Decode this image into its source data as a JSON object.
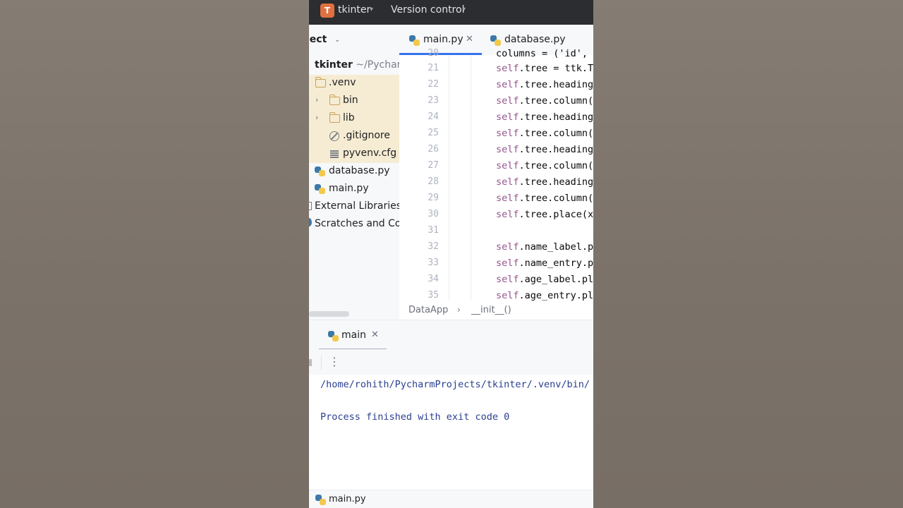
{
  "titlebar": {
    "project_badge": "T",
    "project_name": "tkinter",
    "version_control": "Version control"
  },
  "project_panel": {
    "title": "ject",
    "root": {
      "name": "tkinter",
      "path": "~/Pycharm"
    },
    "items": [
      {
        "label": ".venv",
        "icon": "folder-icon"
      },
      {
        "label": "bin",
        "icon": "folder-icon"
      },
      {
        "label": "lib",
        "icon": "folder-icon"
      },
      {
        "label": ".gitignore",
        "icon": "ignore-file-icon"
      },
      {
        "label": "pyvenv.cfg",
        "icon": "text-file-icon"
      },
      {
        "label": "database.py",
        "icon": "python-icon"
      },
      {
        "label": "main.py",
        "icon": "python-icon"
      },
      {
        "label": "External Libraries",
        "icon": "library-icon"
      },
      {
        "label": "Scratches and Con",
        "icon": "scratches-icon"
      }
    ]
  },
  "editor": {
    "tabs": [
      {
        "label": "main.py",
        "active": true
      },
      {
        "label": "database.py",
        "active": false
      }
    ],
    "partial_line": "columns = ('id',",
    "lines": [
      {
        "num": "21",
        "self": "self",
        "rest": ".tree = ttk.T"
      },
      {
        "num": "22",
        "self": "self",
        "rest": ".tree.heading"
      },
      {
        "num": "23",
        "self": "self",
        "rest": ".tree.column("
      },
      {
        "num": "24",
        "self": "self",
        "rest": ".tree.heading"
      },
      {
        "num": "25",
        "self": "self",
        "rest": ".tree.column("
      },
      {
        "num": "26",
        "self": "self",
        "rest": ".tree.heading"
      },
      {
        "num": "27",
        "self": "self",
        "rest": ".tree.column("
      },
      {
        "num": "28",
        "self": "self",
        "rest": ".tree.heading"
      },
      {
        "num": "29",
        "self": "self",
        "rest": ".tree.column("
      },
      {
        "num": "30",
        "self": "self",
        "rest": ".tree.place(x"
      },
      {
        "num": "31",
        "self": "",
        "rest": ""
      },
      {
        "num": "32",
        "self": "self",
        "rest": ".name_label.p"
      },
      {
        "num": "33",
        "self": "self",
        "rest": ".name_entry.p"
      },
      {
        "num": "34",
        "self": "self",
        "rest": ".age_label.pl"
      },
      {
        "num": "35",
        "self": "self",
        "rest": ".age_entry.pl"
      }
    ],
    "breadcrumb": {
      "class": "DataApp",
      "method": "__init__()"
    }
  },
  "run_panel": {
    "tab_label": "main",
    "console_lines": [
      "/home/rohith/PycharmProjects/tkinter/.venv/bin/",
      "",
      "Process finished with exit code 0"
    ]
  },
  "status_bar": {
    "file": "main.py"
  },
  "colors": {
    "accent": "#3574f0",
    "keyword_self": "#94558d",
    "console_text": "#2a3f8f",
    "venv_highlight": "#f6ecd3"
  }
}
